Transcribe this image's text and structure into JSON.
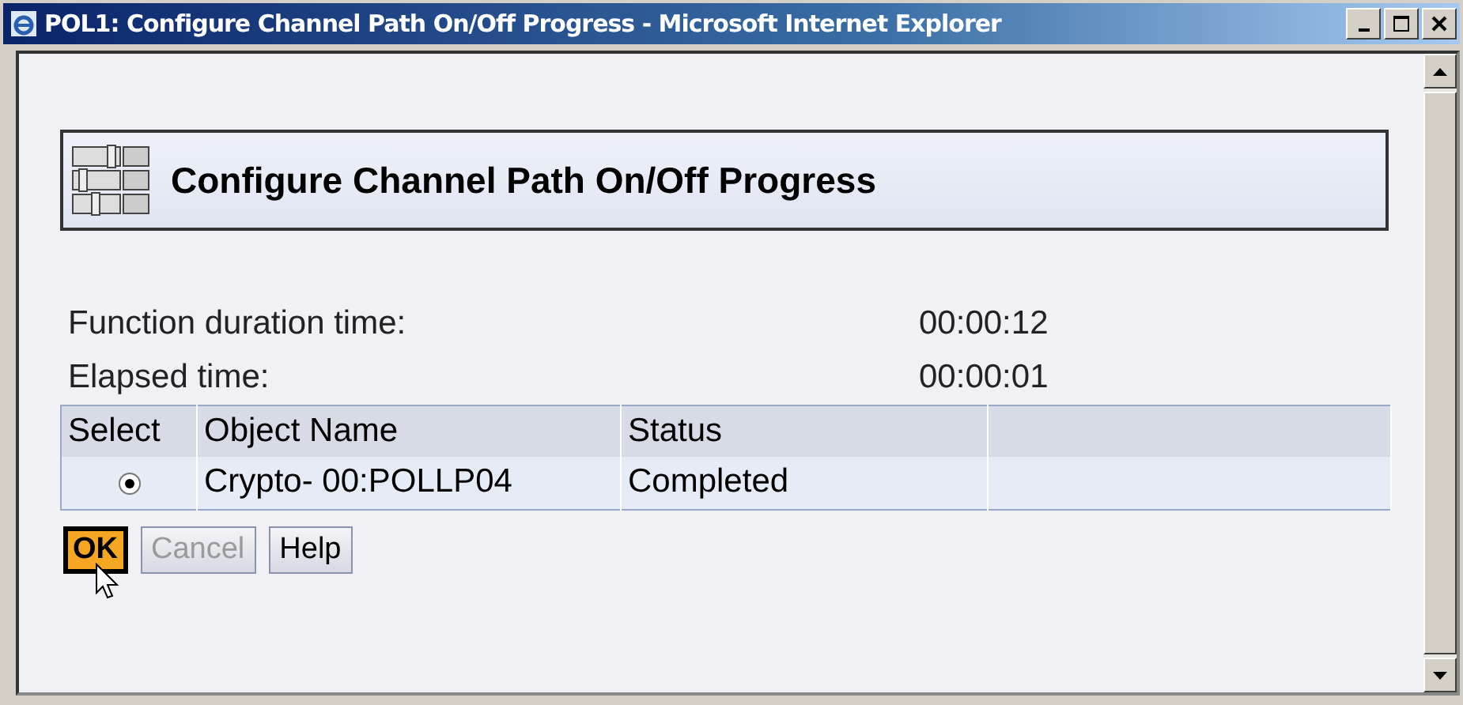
{
  "window": {
    "title": "POL1: Configure Channel Path On/Off Progress - Microsoft Internet Explorer"
  },
  "header": {
    "title": "Configure Channel Path On/Off Progress"
  },
  "fields": [
    {
      "label": "Function duration time:",
      "value": "00:00:12"
    },
    {
      "label": "Elapsed time:",
      "value": "00:00:01"
    }
  ],
  "table": {
    "columns": [
      "Select",
      "Object Name",
      "Status"
    ],
    "rows": [
      {
        "selected": true,
        "object_name": "Crypto- 00:POLLP04",
        "status": "Completed"
      }
    ]
  },
  "buttons": [
    {
      "label": "OK",
      "focused": true,
      "disabled": false
    },
    {
      "label": "Cancel",
      "focused": false,
      "disabled": true
    },
    {
      "label": "Help",
      "focused": false,
      "disabled": false
    }
  ]
}
